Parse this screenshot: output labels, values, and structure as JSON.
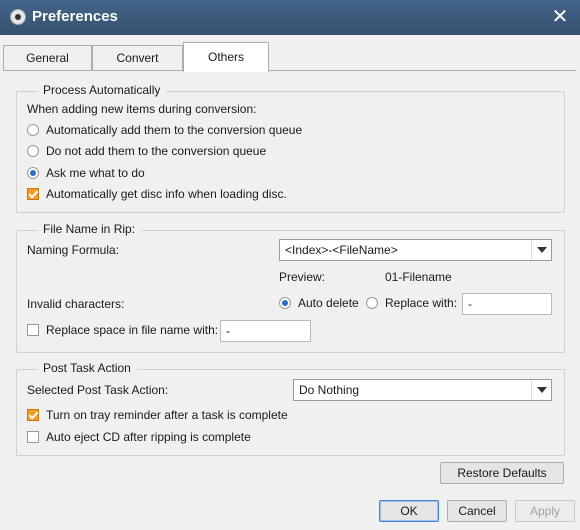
{
  "window": {
    "title": "Preferences"
  },
  "tabs": [
    {
      "label": "General"
    },
    {
      "label": "Convert"
    },
    {
      "label": "Others"
    }
  ],
  "process": {
    "legend": "Process Automatically",
    "intro": "When adding new items during conversion:",
    "option1": "Automatically add them to the conversion queue",
    "option2": "Do not add them to the conversion queue",
    "option3": "Ask me what to do",
    "disc_info": "Automatically get disc info when loading disc."
  },
  "filename": {
    "legend": "File Name in Rip:",
    "naming_label": "Naming Formula:",
    "naming_value": "<Index>-<FileName>",
    "preview_label": "Preview:",
    "preview_value": "01-Filename",
    "invalid_label": "Invalid characters:",
    "auto_delete": "Auto delete",
    "replace_with": "Replace with:",
    "replace_value": "-",
    "replace_space": "Replace space in file name with:",
    "replace_space_value": "-"
  },
  "post": {
    "legend": "Post Task Action",
    "selected_label": "Selected Post Task Action:",
    "selected_value": "Do Nothing",
    "tray": "Turn on tray reminder after a task is complete",
    "eject": "Auto eject CD after ripping is complete"
  },
  "buttons": {
    "restore": "Restore Defaults",
    "ok": "OK",
    "cancel": "Cancel",
    "apply": "Apply"
  }
}
